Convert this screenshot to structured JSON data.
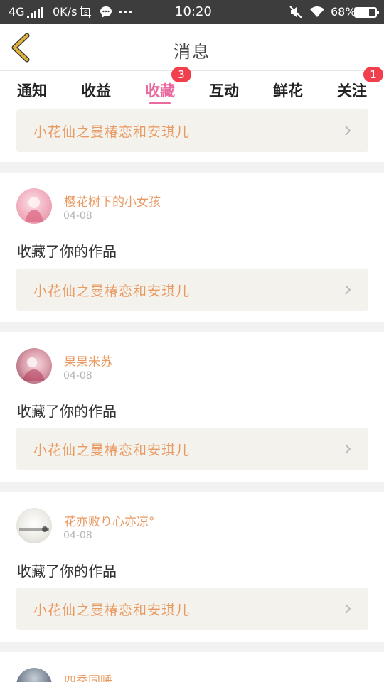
{
  "status_bar": {
    "network": "4G",
    "speed": "0K/s",
    "time": "10:20",
    "battery": "68%",
    "battery_level": 0.68,
    "icons": [
      "signal-icon",
      "screenshot-icon",
      "message-icon",
      "more-icon",
      "mute-icon",
      "wifi-icon",
      "battery-icon"
    ]
  },
  "header": {
    "title": "消息",
    "back_icon": "back-chevron-icon"
  },
  "tabs": [
    {
      "label": "通知",
      "badge": ""
    },
    {
      "label": "收益",
      "badge": ""
    },
    {
      "label": "收藏",
      "badge": "3"
    },
    {
      "label": "互动",
      "badge": ""
    },
    {
      "label": "鲜花",
      "badge": ""
    },
    {
      "label": "关注",
      "badge": "1"
    }
  ],
  "active_tab": "收藏",
  "feed": {
    "top_partial_work": "小花仙之曼椿恋和安琪儿",
    "items": [
      {
        "user": "樱花树下的小女孩",
        "date": "04-08",
        "action": "收藏了你的作品",
        "work": "小花仙之曼椿恋和安琪儿"
      },
      {
        "user": "果果米苏",
        "date": "04-08",
        "action": "收藏了你的作品",
        "work": "小花仙之曼椿恋和安琪儿"
      },
      {
        "user": "花亦败り心亦凉°",
        "date": "04-08",
        "action": "收藏了你的作品",
        "work": "小花仙之曼椿恋和安琪儿"
      },
      {
        "user": "四季同睡",
        "date": "",
        "action": "",
        "work": ""
      }
    ]
  },
  "colors": {
    "accent_pink": "#ea6aa0",
    "work_orange": "#e99a63",
    "badge_red": "#f13f4e",
    "back_yellow": "#e0b23a",
    "status_bar": "#3d3d3d"
  }
}
